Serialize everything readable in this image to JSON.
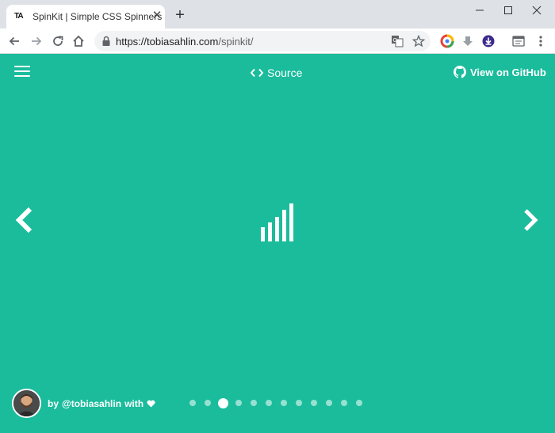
{
  "browser": {
    "tab": {
      "favicon_text": "TA",
      "title": "SpinKit | Simple CSS Spinners",
      "close_glyph": "✕"
    },
    "new_tab_glyph": "+",
    "window_controls": {
      "minimize": "—",
      "maximize": "☐",
      "close": "✕"
    },
    "address": {
      "scheme": "https://",
      "host": "tobiasahlin.com",
      "path": "/spinkit/"
    },
    "icons": [
      "back-icon",
      "forward-icon",
      "reload-icon",
      "home-icon",
      "lock-icon",
      "translate-icon",
      "star-icon",
      "extension-icons",
      "menu-icon"
    ]
  },
  "page": {
    "background": "#1abc9c",
    "header": {
      "source_label": "Source",
      "github_label": "View on GitHub"
    },
    "footer": {
      "by_label": "by",
      "handle": "@tobiasahlin",
      "with_label": "with"
    },
    "pagination": {
      "count": 12,
      "active_index": 2
    }
  }
}
